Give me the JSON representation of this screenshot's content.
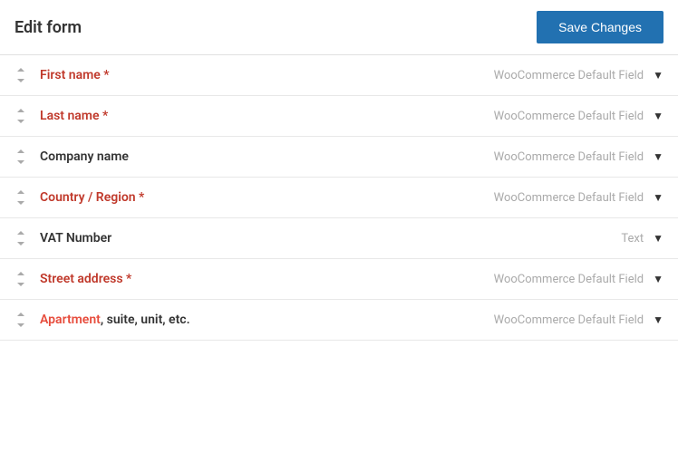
{
  "header": {
    "title": "Edit form",
    "save_button_label": "Save Changes"
  },
  "fields": [
    {
      "id": 1,
      "label": "First name",
      "required": true,
      "type_label": "WooCommerce Default Field",
      "label_style": "required",
      "parts": [
        {
          "text": "First name *",
          "style": "required"
        }
      ]
    },
    {
      "id": 2,
      "label": "Last name",
      "required": true,
      "type_label": "WooCommerce Default Field",
      "label_style": "required",
      "parts": [
        {
          "text": "Last name *",
          "style": "required"
        }
      ]
    },
    {
      "id": 3,
      "label": "Company name",
      "required": false,
      "type_label": "WooCommerce Default Field",
      "label_style": "optional",
      "parts": [
        {
          "text": "Company name",
          "style": "optional"
        }
      ]
    },
    {
      "id": 4,
      "label": "Country / Region",
      "required": true,
      "type_label": "WooCommerce Default Field",
      "label_style": "required",
      "parts": [
        {
          "text": "Country / Region *",
          "style": "required"
        }
      ]
    },
    {
      "id": 5,
      "label": "VAT Number",
      "required": false,
      "type_label": "Text",
      "label_style": "optional",
      "parts": [
        {
          "text": "VAT Number",
          "style": "optional"
        }
      ]
    },
    {
      "id": 6,
      "label": "Street address",
      "required": true,
      "type_label": "WooCommerce Default Field",
      "label_style": "required",
      "parts": [
        {
          "text": "Street address *",
          "style": "required"
        }
      ]
    },
    {
      "id": 7,
      "label": "Apartment, suite, unit, etc.",
      "required": false,
      "type_label": "WooCommerce Default Field",
      "label_style": "highlight",
      "parts": [
        {
          "text": "Apartment",
          "style": "highlight"
        },
        {
          "text": ", suite, unit, etc.",
          "style": "optional"
        }
      ]
    }
  ]
}
